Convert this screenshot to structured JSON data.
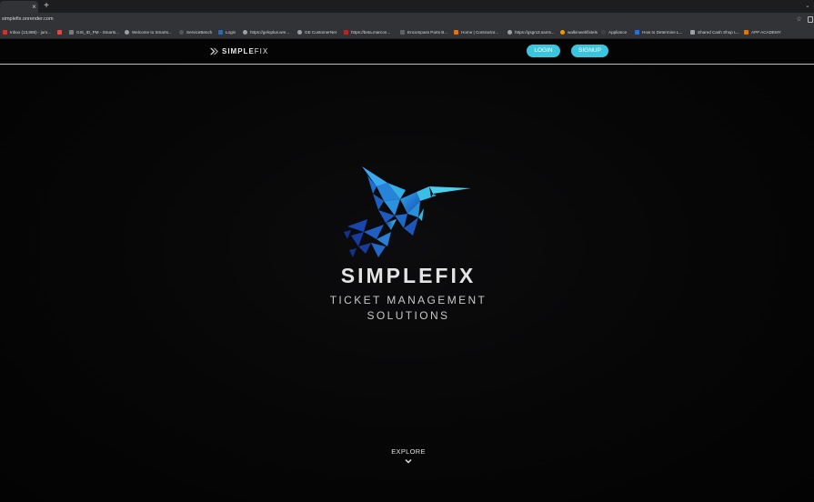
{
  "browser": {
    "tab_close": "×",
    "new_tab": "+",
    "url": "simplefix.onrender.com",
    "bookmarks": [
      {
        "label": "Inbox (13,888) - jum...",
        "color": "#d93025"
      },
      {
        "label": "",
        "color": "#e8453c"
      },
      {
        "label": "GIS_ID_PM - Smarts...",
        "color": "#7a7a7a"
      },
      {
        "label": "Welcome to Smarts...",
        "color": "#9aa0a6"
      },
      {
        "label": "ServiceBench",
        "color": "#555555"
      },
      {
        "label": "Login",
        "color": "#2b6cb0"
      },
      {
        "label": "https://geloplus.wm...",
        "color": "#9aa0a6"
      },
      {
        "label": "GE CustomerNet",
        "color": "#9aa0a6"
      },
      {
        "label": "https://beta.marcon...",
        "color": "#c5221f"
      },
      {
        "label": "Encompass Parts B...",
        "color": "#5f6368"
      },
      {
        "label": "Home | Contractor...",
        "color": "#e8710a"
      },
      {
        "label": "https://gsgrx3.sams...",
        "color": "#9aa0a6"
      },
      {
        "label": "walkinwebfixtels",
        "color": "#f29900"
      },
      {
        "label": "Appliance",
        "color": "#3c4043"
      },
      {
        "label": "How to Determine L...",
        "color": "#1a73e8"
      },
      {
        "label": "Shared Cash Shop L...",
        "color": "#9aa0a6"
      },
      {
        "label": "APP ACADEMY",
        "color": "#e37400"
      }
    ]
  },
  "navbar": {
    "brand_simple": "SIMPLE",
    "brand_fix": "FIX",
    "login_label": "LOGIN",
    "signup_label": "SIGNUP",
    "accent": "#3cc6dd"
  },
  "hero": {
    "title": "SIMPLEFIX",
    "subtitle_line1": "TICKET MANAGEMENT",
    "subtitle_line2": "SOLUTIONS",
    "logo_icon": "hummingbird-logo",
    "explore_label": "EXPLORE",
    "explore_icon": "chevron-down-icon"
  }
}
